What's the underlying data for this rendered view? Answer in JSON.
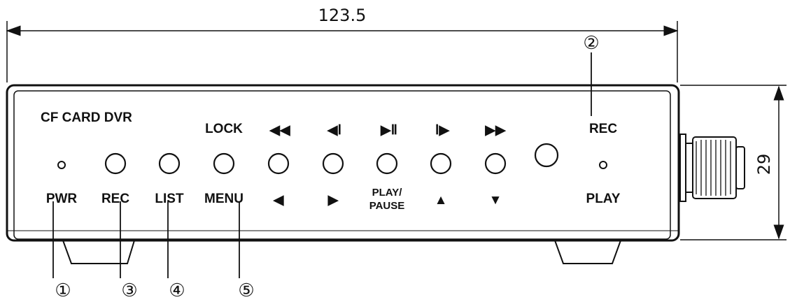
{
  "dimensions": {
    "width": "123.5",
    "height": "29"
  },
  "device": {
    "title": "CF CARD DVR"
  },
  "top_labels": {
    "lock": "LOCK",
    "rec": "REC",
    "rewind": "◀◀",
    "step_back": "◀Ⅰ",
    "play_pause": "▶Ⅱ",
    "step_forward": "Ⅰ▶",
    "fast_forward": "▶▶"
  },
  "bottom_labels": {
    "pwr": "PWR",
    "rec": "REC",
    "list": "LIST",
    "menu": "MENU",
    "left": "◀",
    "right": "▶",
    "play_line1": "PLAY/",
    "play_line2": "PAUSE",
    "up": "▲",
    "down": "▼",
    "play": "PLAY"
  },
  "callouts": {
    "c1": "①",
    "c2": "②",
    "c3": "③",
    "c4": "④",
    "c5": "⑤"
  }
}
